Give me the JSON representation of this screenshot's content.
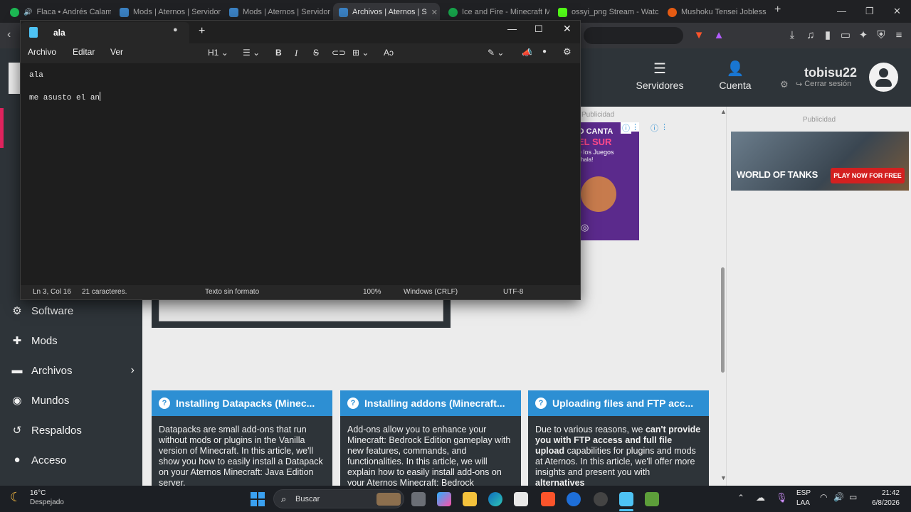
{
  "browser": {
    "tabs": [
      {
        "label": "Flaca • Andrés Calamaro",
        "color": "#1db954",
        "active": false
      },
      {
        "label": "Mods | Aternos | Servidor",
        "color": "#3b82c4",
        "active": false
      },
      {
        "label": "Mods | Aternos | Servidor",
        "color": "#3b82c4",
        "active": false
      },
      {
        "label": "Archivos | Aternos | S",
        "color": "#3b82c4",
        "active": true
      },
      {
        "label": "Ice and Fire - Minecraft M",
        "color": "#16a34a",
        "active": false
      },
      {
        "label": "ossyi_png Stream - Watch",
        "color": "#53fc18",
        "active": false
      },
      {
        "label": "Mushoku Tensei Jobless R",
        "color": "#e55b13",
        "active": false
      }
    ],
    "new_tab": "+"
  },
  "site": {
    "header": {
      "servers_label": "Servidores",
      "account_label": "Cuenta",
      "username": "tobisu22",
      "logout_label": "Cerrar sesión"
    },
    "sidebar": {
      "items": [
        {
          "label": "Software",
          "icon": "gear-icon"
        },
        {
          "label": "Mods",
          "icon": "puzzle-icon"
        },
        {
          "label": "Archivos",
          "icon": "folder-icon"
        },
        {
          "label": "Mundos",
          "icon": "globe-icon"
        },
        {
          "label": "Respaldos",
          "icon": "history-icon"
        },
        {
          "label": "Acceso",
          "icon": "user-icon"
        }
      ]
    },
    "ads": {
      "label_main": "Publicidad",
      "label_right": "Publicidad",
      "wot_title": "WORLD OF TANKS",
      "wot_cta": "PLAY NOW FOR FREE",
      "ad2_line1": "O CANTA",
      "ad2_line2": "EL SUR",
      "ad2_line3": "e los Juegos",
      "ad2_line4": "chala!"
    },
    "cards": [
      {
        "title": "Installing Datapacks (Minec...",
        "body": "Datapacks are small add-ons that run without mods or plugins in the Vanilla version of Minecraft. In this article, we'll show you how to easily install a Datapack on your Aternos Minecraft: Java Edition server."
      },
      {
        "title": "Installing addons (Minecraft...",
        "body": "Add-ons allow you to enhance your Minecraft: Bedrock Edition gameplay with new features, commands, and functionalities. In this article, we will explain how to easily install add-ons on your Aternos Minecraft: Bedrock"
      },
      {
        "title": "Uploading files and FTP acc...",
        "body_pre": "Due to various reasons, we ",
        "body_bold1": "can't provide you with FTP access and full file upload",
        "body_mid": " capabilities for plugins and mods at Aternos. In this article, we'll offer more insights and present you with ",
        "body_bold2": "alternatives"
      }
    ]
  },
  "notepad": {
    "tab_title": "ala",
    "new_tab": "+",
    "menu": [
      "Archivo",
      "Editar",
      "Ver"
    ],
    "heading_select": "H1",
    "lines": [
      "ala",
      "",
      "me asusto el an"
    ],
    "status": {
      "position": "Ln 3, Col 16",
      "chars": "21 caracteres.",
      "format": "Texto sin formato",
      "zoom": "100%",
      "line_ending": "Windows (CRLF)",
      "encoding": "UTF-8"
    }
  },
  "taskbar": {
    "weather_temp": "16°C",
    "weather_desc": "Despejado",
    "search_placeholder": "Buscar",
    "lang": "ESP",
    "lang2": "LAA",
    "time": "21:42",
    "date": "6/8/2026"
  },
  "colors": {
    "aternos_dark": "#2e3439",
    "aternos_blue": "#2d8fd3",
    "notepad_bg": "#1e1e1e"
  }
}
